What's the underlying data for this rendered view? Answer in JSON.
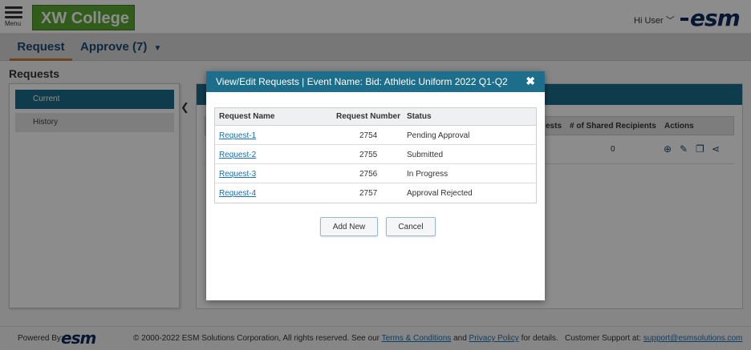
{
  "header": {
    "menu_label": "Menu",
    "college_name": "XW College",
    "user_greeting": "Hi User",
    "brand": "esm"
  },
  "tabs": [
    {
      "label": "Request"
    },
    {
      "label": "Approve (7)"
    }
  ],
  "section_title": "Requests",
  "sidebar": {
    "items": [
      {
        "label": "Current"
      },
      {
        "label": "History"
      }
    ]
  },
  "grid": {
    "columns": {
      "requests_partial": "ests",
      "shared_recipients": "# of Shared Recipients",
      "actions": "Actions"
    },
    "rows": [
      {
        "shared_recipients": "0"
      }
    ]
  },
  "modal": {
    "title": "View/Edit Requests | Event Name: Bid: Athletic Uniform 2022 Q1-Q2",
    "close_symbol": "✖",
    "columns": {
      "name": "Request Name",
      "number": "Request Number",
      "status": "Status"
    },
    "rows": [
      {
        "name": "Request-1",
        "number": "2754",
        "status": "Pending Approval"
      },
      {
        "name": "Request-2",
        "number": "2755",
        "status": "Submitted"
      },
      {
        "name": "Request-3",
        "number": "2756",
        "status": "In Progress"
      },
      {
        "name": "Request-4",
        "number": "2757",
        "status": "Approval Rejected"
      }
    ],
    "add_new_label": "Add New",
    "cancel_label": "Cancel"
  },
  "footer": {
    "powered_by": "Powered By:",
    "copyright": "© 2000-2022 ESM Solutions Corporation, All rights reserved. See our",
    "terms_link": "Terms & Conditions",
    "and_text": "and",
    "privacy_link": "Privacy Policy",
    "details_text": "for details.",
    "support_label": "Customer Support at:",
    "support_email": "support@esmsolutions.com"
  },
  "colors": {
    "primary": "#1d6e8a",
    "college_green": "#5aa832",
    "brand_navy": "#0d2b5c",
    "link": "#1a6fb5",
    "tab_accent": "#c97d3a"
  }
}
